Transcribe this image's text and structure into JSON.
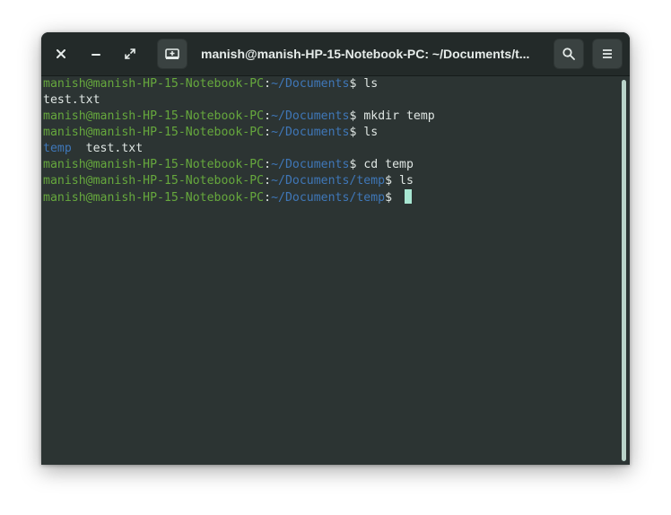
{
  "window": {
    "title": "manish@manish-HP-15-Notebook-PC: ~/Documents/t..."
  },
  "titlebar": {
    "close_icon": "close-icon",
    "minimize_icon": "minimize-icon",
    "maximize_icon": "maximize-icon",
    "new_tab_icon": "new-tab-icon",
    "search_icon": "search-icon",
    "menu_icon": "hamburger-menu-icon"
  },
  "terminal": {
    "user_host": "manish@manish-HP-15-Notebook-PC",
    "colon": ":",
    "lines": [
      {
        "type": "prompt",
        "path": "~/Documents",
        "cmd": "ls"
      },
      {
        "type": "output",
        "parts": [
          {
            "text": "test.txt",
            "kind": "file"
          }
        ]
      },
      {
        "type": "prompt",
        "path": "~/Documents",
        "cmd": "mkdir temp"
      },
      {
        "type": "prompt",
        "path": "~/Documents",
        "cmd": "ls"
      },
      {
        "type": "output",
        "parts": [
          {
            "text": "temp",
            "kind": "dir"
          },
          {
            "text": "  test.txt",
            "kind": "file"
          }
        ]
      },
      {
        "type": "prompt",
        "path": "~/Documents",
        "cmd": "cd temp"
      },
      {
        "type": "prompt",
        "path": "~/Documents/temp",
        "cmd": "ls"
      },
      {
        "type": "prompt",
        "path": "~/Documents/temp",
        "cmd": ""
      }
    ]
  },
  "colors": {
    "user_host": "#66a83d",
    "path": "#3f77b8",
    "text": "#dfe6e3",
    "cursor": "#a8e6d2",
    "background": "#2c3433"
  }
}
